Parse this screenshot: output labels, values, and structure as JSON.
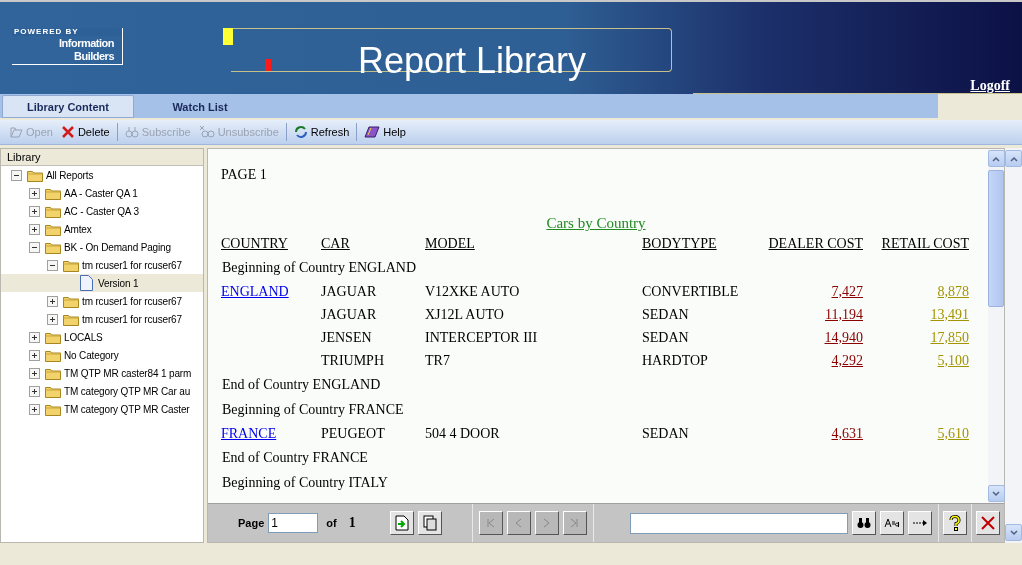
{
  "header": {
    "logo": {
      "line_1": "POWERED BY",
      "line_2": "Information",
      "line_3": "Builders"
    },
    "title": "Report Library",
    "logoff": "Logoff"
  },
  "tabs": [
    {
      "label": "Library Content",
      "selected": true
    },
    {
      "label": "Watch List",
      "selected": false
    }
  ],
  "toolbar": [
    {
      "label": "Open",
      "disabled": true
    },
    {
      "label": "Delete",
      "disabled": false
    },
    {
      "label": "Subscribe",
      "disabled": true
    },
    {
      "label": "Unsubscribe",
      "disabled": true
    },
    {
      "label": "Refresh",
      "disabled": false
    },
    {
      "label": "Help",
      "disabled": false
    }
  ],
  "sidebar": {
    "title": "Library",
    "tree": [
      {
        "label": "All Reports",
        "kind": "folder",
        "expanded": true,
        "selected": false,
        "children": [
          {
            "label": "AA - Caster QA 1",
            "kind": "folder",
            "expanded": false,
            "selected": false
          },
          {
            "label": "AC - Caster QA 3",
            "kind": "folder",
            "expanded": false,
            "selected": false
          },
          {
            "label": "Amtex",
            "kind": "folder",
            "expanded": false,
            "selected": false
          },
          {
            "label": "BK - On Demand Paging",
            "kind": "folder",
            "expanded": true,
            "selected": false,
            "children": [
              {
                "label": "tm rcuser1 for rcuser67",
                "kind": "folder",
                "expanded": true,
                "selected": false,
                "children": [
                  {
                    "label": "Version 1",
                    "kind": "report",
                    "selected": true
                  }
                ]
              },
              {
                "label": "tm rcuser1 for rcuser67",
                "kind": "folder",
                "expanded": false,
                "selected": false
              },
              {
                "label": "tm rcuser1 for rcuser67",
                "kind": "folder",
                "expanded": false,
                "selected": false
              }
            ]
          },
          {
            "label": "LOCALS",
            "kind": "folder",
            "expanded": false,
            "selected": false
          },
          {
            "label": "No Category",
            "kind": "folder",
            "expanded": false,
            "selected": false
          },
          {
            "label": "TM QTP MR caster84 1 parm",
            "kind": "folder",
            "expanded": false,
            "selected": false
          },
          {
            "label": "TM category QTP MR Car au",
            "kind": "folder",
            "expanded": false,
            "selected": false
          },
          {
            "label": "TM category QTP MR Caster",
            "kind": "folder",
            "expanded": false,
            "selected": false
          }
        ]
      }
    ]
  },
  "report": {
    "page_label": "PAGE 1",
    "title": "Cars by Country",
    "columns": [
      "COUNTRY",
      "CAR",
      "MODEL",
      "BODYTYPE",
      "DEALER COST",
      "RETAIL COST"
    ],
    "rows": [
      {
        "kind": "note",
        "text": "Beginning of Country ENGLAND"
      },
      {
        "kind": "data",
        "country": "ENGLAND",
        "car": "JAGUAR",
        "model": "V12XKE AUTO",
        "bodytype": "CONVERTIBLE",
        "dealer_cost": "7,427",
        "retail_cost": "8,878"
      },
      {
        "kind": "data",
        "car": "JAGUAR",
        "model": "XJ12L AUTO",
        "bodytype": "SEDAN",
        "dealer_cost": "11,194",
        "retail_cost": "13,491"
      },
      {
        "kind": "data",
        "car": "JENSEN",
        "model": "INTERCEPTOR III",
        "bodytype": "SEDAN",
        "dealer_cost": "14,940",
        "retail_cost": "17,850"
      },
      {
        "kind": "data",
        "car": "TRIUMPH",
        "model": "TR7",
        "bodytype": "HARDTOP",
        "dealer_cost": "4,292",
        "retail_cost": "5,100"
      },
      {
        "kind": "note",
        "text": "End of Country ENGLAND"
      },
      {
        "kind": "note",
        "text": "Beginning of Country FRANCE"
      },
      {
        "kind": "data",
        "country": "FRANCE",
        "car": "PEUGEOT",
        "model": "504 4 DOOR",
        "bodytype": "SEDAN",
        "dealer_cost": "4,631",
        "retail_cost": "5,610"
      },
      {
        "kind": "note",
        "text": "End of Country FRANCE"
      },
      {
        "kind": "note",
        "text": "Beginning of Country ITALY"
      }
    ]
  },
  "pager": {
    "page_label": "Page",
    "page_value": "1",
    "of_label": "of",
    "total": "1"
  }
}
